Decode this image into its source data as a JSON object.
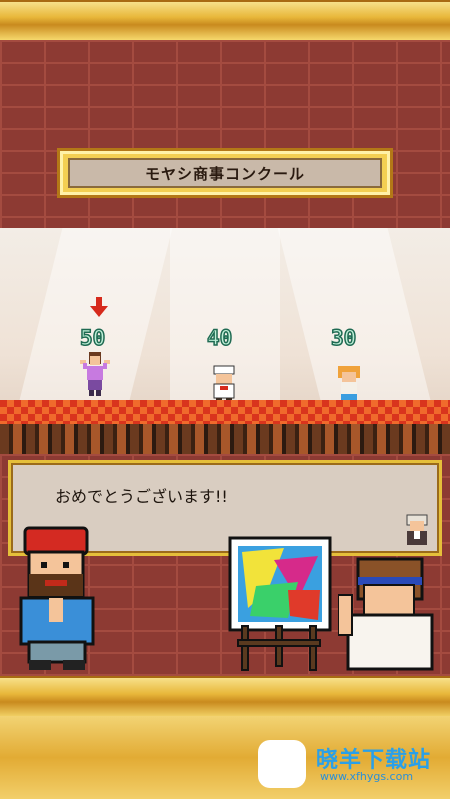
{
  "contest": {
    "title": "モヤシ商事コンクール"
  },
  "contestants": [
    {
      "score": "50",
      "winner": true
    },
    {
      "score": "40",
      "winner": false
    },
    {
      "score": "30",
      "winner": false
    }
  ],
  "dialog": {
    "message": "おめでとうございます!!"
  },
  "watermark": {
    "name": "晓羊下载站",
    "url": "www.xfhygs.com"
  },
  "colors": {
    "brick": "#8d3a33",
    "gold": "#e8b73a",
    "score_text": "#bff0d8",
    "floor_red": "#d9341d"
  },
  "icons": [
    "winner-arrow-icon",
    "painting-icon"
  ]
}
